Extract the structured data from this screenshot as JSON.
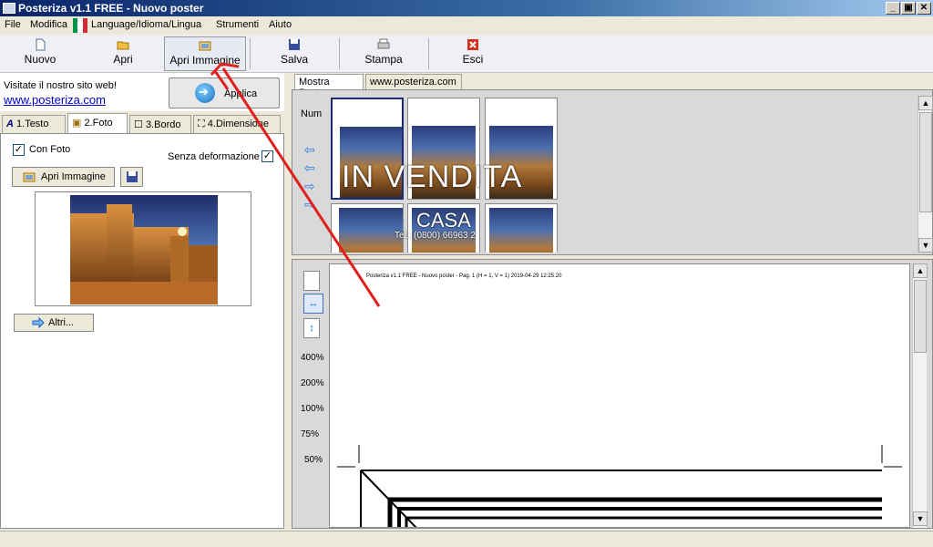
{
  "window": {
    "title": "Posteriza v1.1 FREE - Nuovo poster",
    "controls": [
      "_",
      "▣",
      "✕"
    ]
  },
  "menu": [
    "File",
    "Modifica",
    "Language/Idioma/Lingua",
    "Strumenti",
    "Aiuto"
  ],
  "toolbar": {
    "nuovo": "Nuovo",
    "apri": "Apri",
    "apri_immagine": "Apri Immagine",
    "salva": "Salva",
    "stampa": "Stampa",
    "esci": "Esci"
  },
  "left": {
    "visit_text": "Visitate il nostro sito web!",
    "link": "www.posteriza.com",
    "apply_label": "Applica",
    "tabs": [
      "1.Testo",
      "2.Foto",
      "3.Bordo",
      "4.Dimensione"
    ],
    "active_tab": "2.Foto",
    "con_foto_label": "Con Foto",
    "con_foto_checked": "✓",
    "senza_deformazione_label": "Senza deformazione",
    "senza_deformazione_checked": "✓",
    "apri_immagine_button": "Apri Immagine",
    "altri_button": "Altri..."
  },
  "right": {
    "tabs": [
      "Mostra Poster",
      "www.posteriza.com"
    ],
    "num_label": "Num",
    "poster_text": {
      "main": "IN VENDITA",
      "sub": "CASA",
      "tel": "Tel.: (0800) 66963 2"
    },
    "zoom_levels": [
      "400%",
      "200%",
      "100%",
      "75%",
      "50%"
    ],
    "page_header": "Posteriza v1.1 FREE - Nuovo poster - Pag. 1 (H = 1, V = 1) 2019-04-29 12:25:20"
  },
  "colors": {
    "titlebar": "#0a246a",
    "arrow": "#e0201c",
    "link": "#0000cc"
  }
}
